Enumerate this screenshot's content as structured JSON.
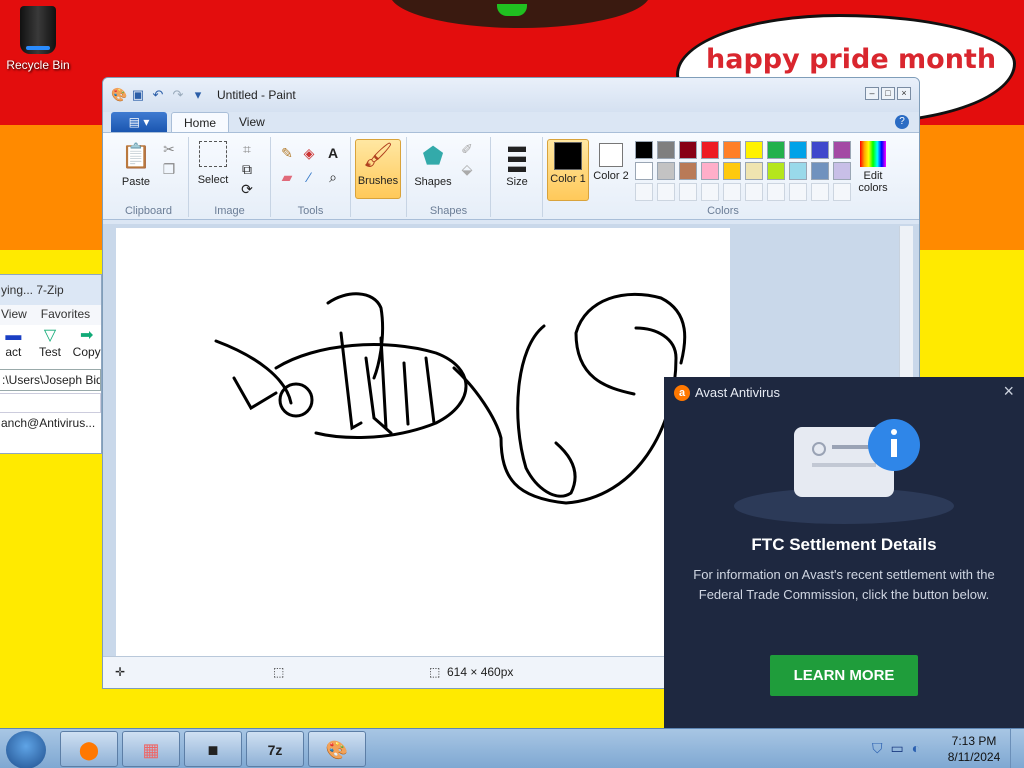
{
  "desktop": {
    "cloud_text": "happy pride month",
    "icons": [
      {
        "label": "Recycle Bin",
        "icon": "recycle-bin-icon"
      }
    ]
  },
  "zip": {
    "title": "ying... 7-Zip",
    "menu": [
      "View",
      "Favorites"
    ],
    "tools": [
      {
        "label": "act"
      },
      {
        "label": "Test"
      },
      {
        "label": "Copy"
      }
    ],
    "path": ":\\Users\\Joseph Bide",
    "item": "anch@Antivirus..."
  },
  "paint": {
    "title": "Untitled - Paint",
    "tabs": [
      "Home",
      "View"
    ],
    "help": "?",
    "groups": {
      "clipboard": "Clipboard",
      "image": "Image",
      "tools": "Tools",
      "shapes": "Shapes",
      "colors": "Colors"
    },
    "buttons": {
      "paste": "Paste",
      "select": "Select",
      "brushes": "Brushes",
      "shapes": "Shapes",
      "size": "Size",
      "color1": "Color 1",
      "color2": "Color 2",
      "edit_colors": "Edit colors"
    },
    "palette_row1": [
      "#000000",
      "#7f7f7f",
      "#880015",
      "#ed1c24",
      "#ff7f27",
      "#fff200",
      "#22b14c",
      "#00a2e8",
      "#3f48cc",
      "#a349a4"
    ],
    "palette_row2": [
      "#ffffff",
      "#c3c3c3",
      "#b97a57",
      "#ffaec9",
      "#ffc90e",
      "#efe4b0",
      "#b5e61d",
      "#99d9ea",
      "#7092be",
      "#c8bfe7"
    ],
    "status": {
      "size": "614 × 460px"
    }
  },
  "avast": {
    "title": "Avast Antivirus",
    "heading": "FTC Settlement Details",
    "body": "For information on Avast's recent settlement with the Federal Trade Commission, click the button below.",
    "button": "LEARN MORE"
  },
  "taskbar": {
    "time": "7:13 PM",
    "date": "8/11/2024"
  }
}
